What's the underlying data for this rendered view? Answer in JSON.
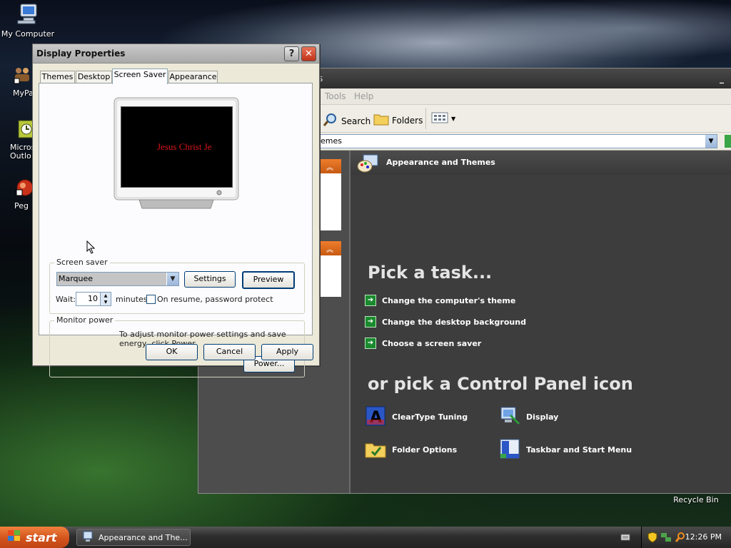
{
  "desktop": {
    "icons": [
      {
        "label": "My Computer"
      },
      {
        "label": "MyPa"
      },
      {
        "label": "Micros Outlo"
      },
      {
        "label": "Peg"
      }
    ],
    "recycle_bin": "Recycle Bin"
  },
  "explorer": {
    "title_fragment": "s",
    "menu": [
      "Tools",
      "Help"
    ],
    "toolbar": {
      "search": "Search",
      "folders": "Folders"
    },
    "address": "emes",
    "header": "Appearance and Themes",
    "pick_task": "Pick a task...",
    "tasks": [
      "Change the computer's theme",
      "Change the desktop background",
      "Choose a screen saver"
    ],
    "pick_icon": "or pick a Control Panel icon",
    "icons": [
      "ClearType Tuning",
      "Display",
      "Folder Options",
      "Taskbar and Start Menu"
    ]
  },
  "dialog": {
    "title": "Display Properties",
    "tabs": [
      "Themes",
      "Desktop",
      "Screen Saver",
      "Appearance"
    ],
    "active_tab": "Screen Saver",
    "preview_text": "Jesus Christ Je",
    "screensaver_group": "Screen saver",
    "screensaver_value": "Marquee",
    "settings": "Settings",
    "preview": "Preview",
    "wait_label": "Wait:",
    "wait_value": "10",
    "minutes": "minutes",
    "password_protect": "On resume, password protect",
    "password_checked": false,
    "monitor_group": "Monitor power",
    "monitor_text": "To adjust monitor power settings and save energy, click Power.",
    "power": "Power...",
    "ok": "OK",
    "cancel": "Cancel",
    "apply": "Apply"
  },
  "taskbar": {
    "start": "start",
    "task": "Appearance and The...",
    "clock": "12:26 PM"
  },
  "colors": {
    "start_orange": "#d2531c",
    "task_green": "#1a8a2e",
    "marquee_red": "#d8141a",
    "dialog_bg": "#ece9d8"
  }
}
